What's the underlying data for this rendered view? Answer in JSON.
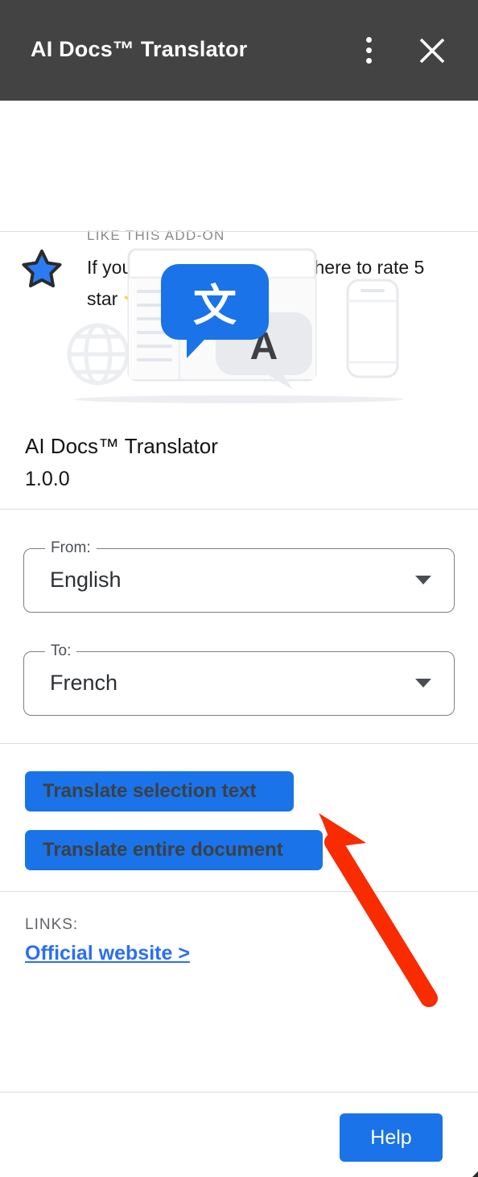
{
  "header": {
    "title": "AI Docs™ Translator",
    "menu_icon": "kebab-menu-icon",
    "close_icon": "close-icon",
    "background_color": "#434343"
  },
  "rate_banner": {
    "kicker": "LIKE THIS ADD-ON",
    "message": "If you like this Add-on, click here to rate 5 star",
    "stars": "⭐⭐⭐⭐⭐",
    "star_icon": "star-icon",
    "star_color": "#2b7cf3"
  },
  "addon": {
    "illustration_icon": "translate-illustration",
    "name": "AI Docs™ Translator",
    "version": "1.0.0"
  },
  "language_selects": [
    {
      "label": "From:",
      "value": "English",
      "caret_icon": "chevron-down-icon"
    },
    {
      "label": "To:",
      "value": "French",
      "caret_icon": "chevron-down-icon"
    }
  ],
  "actions": {
    "translate_selection_label": "Translate selection text",
    "translate_document_label": "Translate entire document",
    "button_color": "#1a73e8",
    "button_text_color": "#3c4043"
  },
  "links": {
    "kicker": "LINKS:",
    "official_website_label": "Official website >",
    "link_color": "#2a6ef5"
  },
  "footer": {
    "help_label": "Help",
    "help_color": "#1a73e8"
  },
  "annotation": {
    "arrow_icon": "red-arrow-pointer",
    "color": "#f92b00"
  }
}
